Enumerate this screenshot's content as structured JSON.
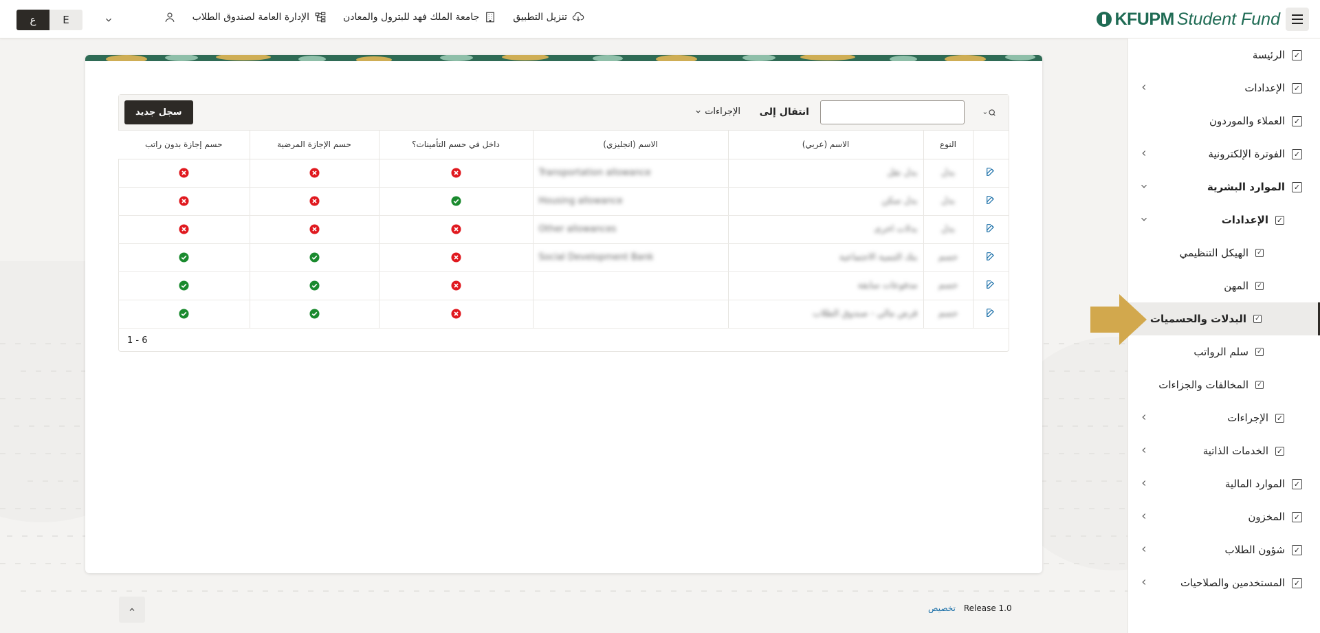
{
  "header": {
    "menu_icon": "hamburger-icon",
    "logo_brand": "KFUPM",
    "logo_sub": "Student Fund",
    "links": [
      {
        "label": "تنزيل التطبيق",
        "icon": "cloud-download-icon"
      },
      {
        "label": "جامعة الملك فهد للبترول والمعادن",
        "icon": "building-icon"
      },
      {
        "label": "الإدارة العامة لصندوق الطلاب",
        "icon": "org-chart-icon"
      }
    ],
    "user_icon": "user-icon",
    "lang_active": "ع",
    "lang_inactive": "E"
  },
  "sidebar": {
    "items": [
      {
        "label": "الرئيسة"
      },
      {
        "label": "الإعدادات"
      },
      {
        "label": "العملاء والموردون"
      },
      {
        "label": "الفوترة الإلكترونية"
      },
      {
        "label": "الموارد البشرية"
      },
      {
        "label": "الإعدادات"
      },
      {
        "label": "الهيكل التنظيمي"
      },
      {
        "label": "المهن"
      },
      {
        "label": "البدلات والحسميات"
      },
      {
        "label": "سلم الرواتب"
      },
      {
        "label": "المخالفات والجزاءات"
      },
      {
        "label": "الإجراءات"
      },
      {
        "label": "الخدمات الذاتية"
      },
      {
        "label": "الموارد المالية"
      },
      {
        "label": "المخزون"
      },
      {
        "label": "شؤون الطلاب"
      },
      {
        "label": "المستخدمين والصلاحيات"
      }
    ]
  },
  "toolbar": {
    "search_value": "",
    "goto_label": "انتقال إلى",
    "actions_label": "الإجراءات",
    "new_label": "سجل جديد"
  },
  "table": {
    "headers": [
      "",
      "النوع",
      "الاسم (عربي)",
      "الاسم (انجليزي)",
      "داخل في حسم التأمينات؟",
      "حسم الإجازة المرضية",
      "حسم إجازة بدون راتب"
    ],
    "rows": [
      {
        "type": "بدل",
        "name_ar": "بدل نقل",
        "name_en": "Transportation allowance",
        "in_gosi": "no",
        "sick_leave": "no",
        "unpaid_leave": "no"
      },
      {
        "type": "بدل",
        "name_ar": "بدل سكن",
        "name_en": "Housing allowance",
        "in_gosi": "yes",
        "sick_leave": "no",
        "unpaid_leave": "no"
      },
      {
        "type": "بدل",
        "name_ar": "بدلات اخرى",
        "name_en": "Other allowances",
        "in_gosi": "no",
        "sick_leave": "no",
        "unpaid_leave": "no"
      },
      {
        "type": "حسم",
        "name_ar": "بنك التنمية الاجتماعية",
        "name_en": "Social Development Bank",
        "in_gosi": "no",
        "sick_leave": "yes",
        "unpaid_leave": "yes"
      },
      {
        "type": "حسم",
        "name_ar": "مدفوعات سابقة",
        "name_en": "",
        "in_gosi": "no",
        "sick_leave": "yes",
        "unpaid_leave": "yes"
      },
      {
        "type": "حسم",
        "name_ar": "قرض مالي - صندوق الطلاب",
        "name_en": "",
        "in_gosi": "no",
        "sick_leave": "yes",
        "unpaid_leave": "yes"
      }
    ],
    "pagination": "1 - 6"
  },
  "footer": {
    "release": "Release 1.0",
    "customize": "تخصيص"
  },
  "colors": {
    "dark": "#2d2a26",
    "brand_green": "#1f6b54",
    "yes": "#1a8a2e",
    "no": "#e0191f",
    "arrow": "#d2a84d",
    "link": "#1a6fa8"
  }
}
